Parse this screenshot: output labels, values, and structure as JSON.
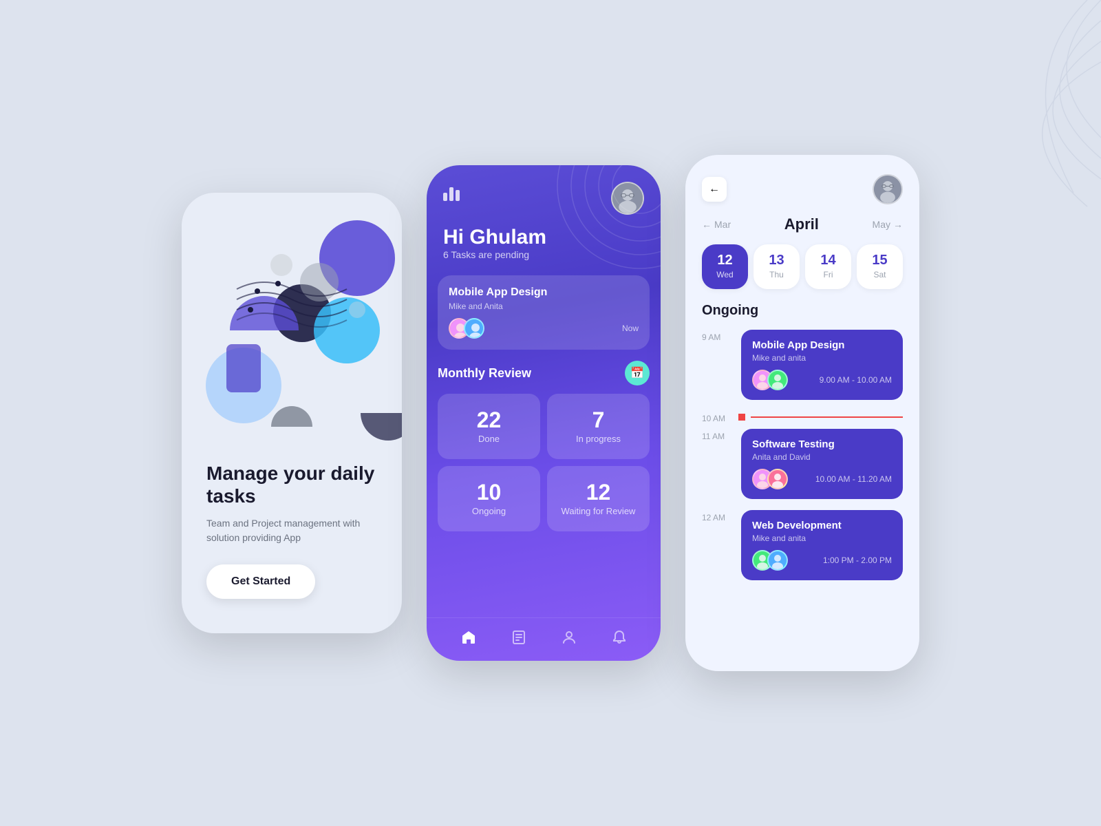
{
  "background": "#dde3ee",
  "phone1": {
    "title": "Manage your daily tasks",
    "subtitle": "Team and Project management with solution providing App",
    "cta": "Get Started"
  },
  "phone2": {
    "greeting": "Hi Ghulam",
    "pending": "6 Tasks are pending",
    "task": {
      "title": "Mobile App Design",
      "people": "Mike and Anita",
      "time": "Now"
    },
    "monthly_review": "Monthly Review",
    "stats": [
      {
        "number": "22",
        "label": "Done"
      },
      {
        "number": "7",
        "label": "In progress"
      },
      {
        "number": "10",
        "label": "Ongoing"
      },
      {
        "number": "12",
        "label": "Waiting for Review"
      }
    ]
  },
  "phone3": {
    "month": "April",
    "prev_month": "Mar",
    "next_month": "May",
    "days": [
      {
        "num": "12",
        "name": "Wed",
        "active": true
      },
      {
        "num": "13",
        "name": "Thu",
        "active": false
      },
      {
        "num": "14",
        "name": "Fri",
        "active": false
      },
      {
        "num": "15",
        "name": "Sat",
        "active": false
      }
    ],
    "ongoing": "Ongoing",
    "events": [
      {
        "time": "9 AM",
        "title": "Mobile App Design",
        "people": "Mike and anita",
        "duration": "9.00 AM - 10.00 AM"
      },
      {
        "time": "10 AM",
        "divider": true
      },
      {
        "time": "11 AM",
        "title": "Software Testing",
        "people": "Anita and David",
        "duration": "10.00 AM - 11.20 AM"
      },
      {
        "time": "12 AM",
        "title": "Web Development",
        "people": "Mike and anita",
        "duration": "1:00 PM - 2.00 PM"
      }
    ]
  }
}
